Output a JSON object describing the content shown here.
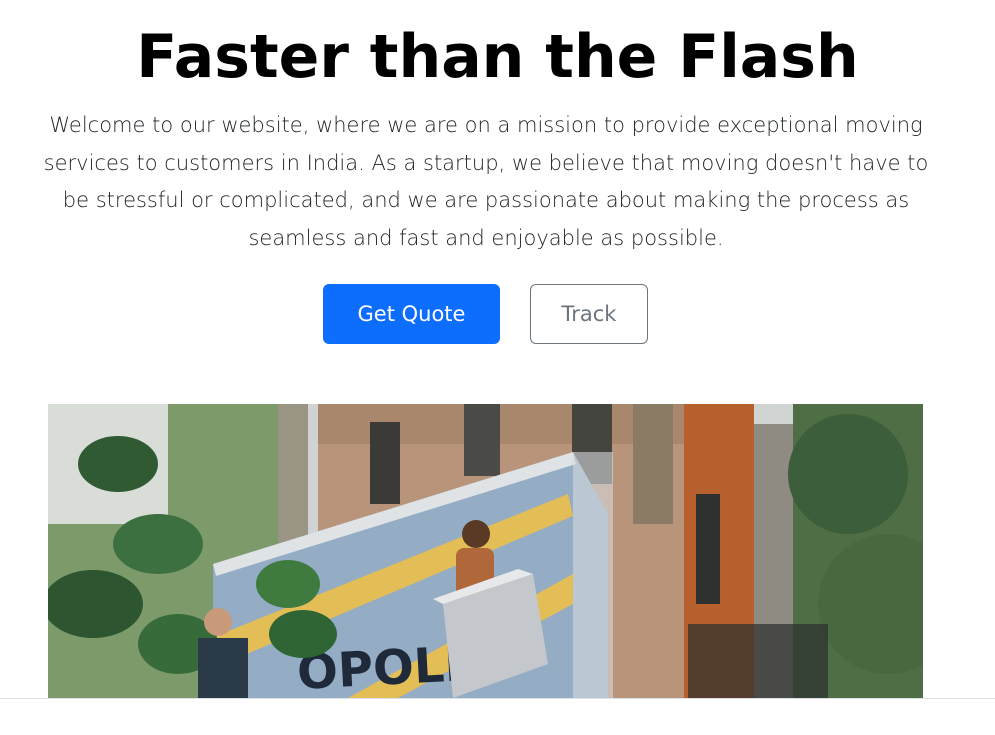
{
  "hero": {
    "title": "Faster than the Flash",
    "lead": "Welcome to our website, where we are on a mission to provide exceptional moving services to customers in India. As a startup, we believe that moving doesn't have to be stressful or complicated, and we are passionate about making the process as seamless and fast and enjoyable as possible.",
    "primary_button": "Get Quote",
    "secondary_button": "Track",
    "image": {
      "truck_lettering": "OPOLIS"
    }
  },
  "colors": {
    "primary": "#0d6efd",
    "secondary": "#6c757d",
    "text": "#212529"
  }
}
